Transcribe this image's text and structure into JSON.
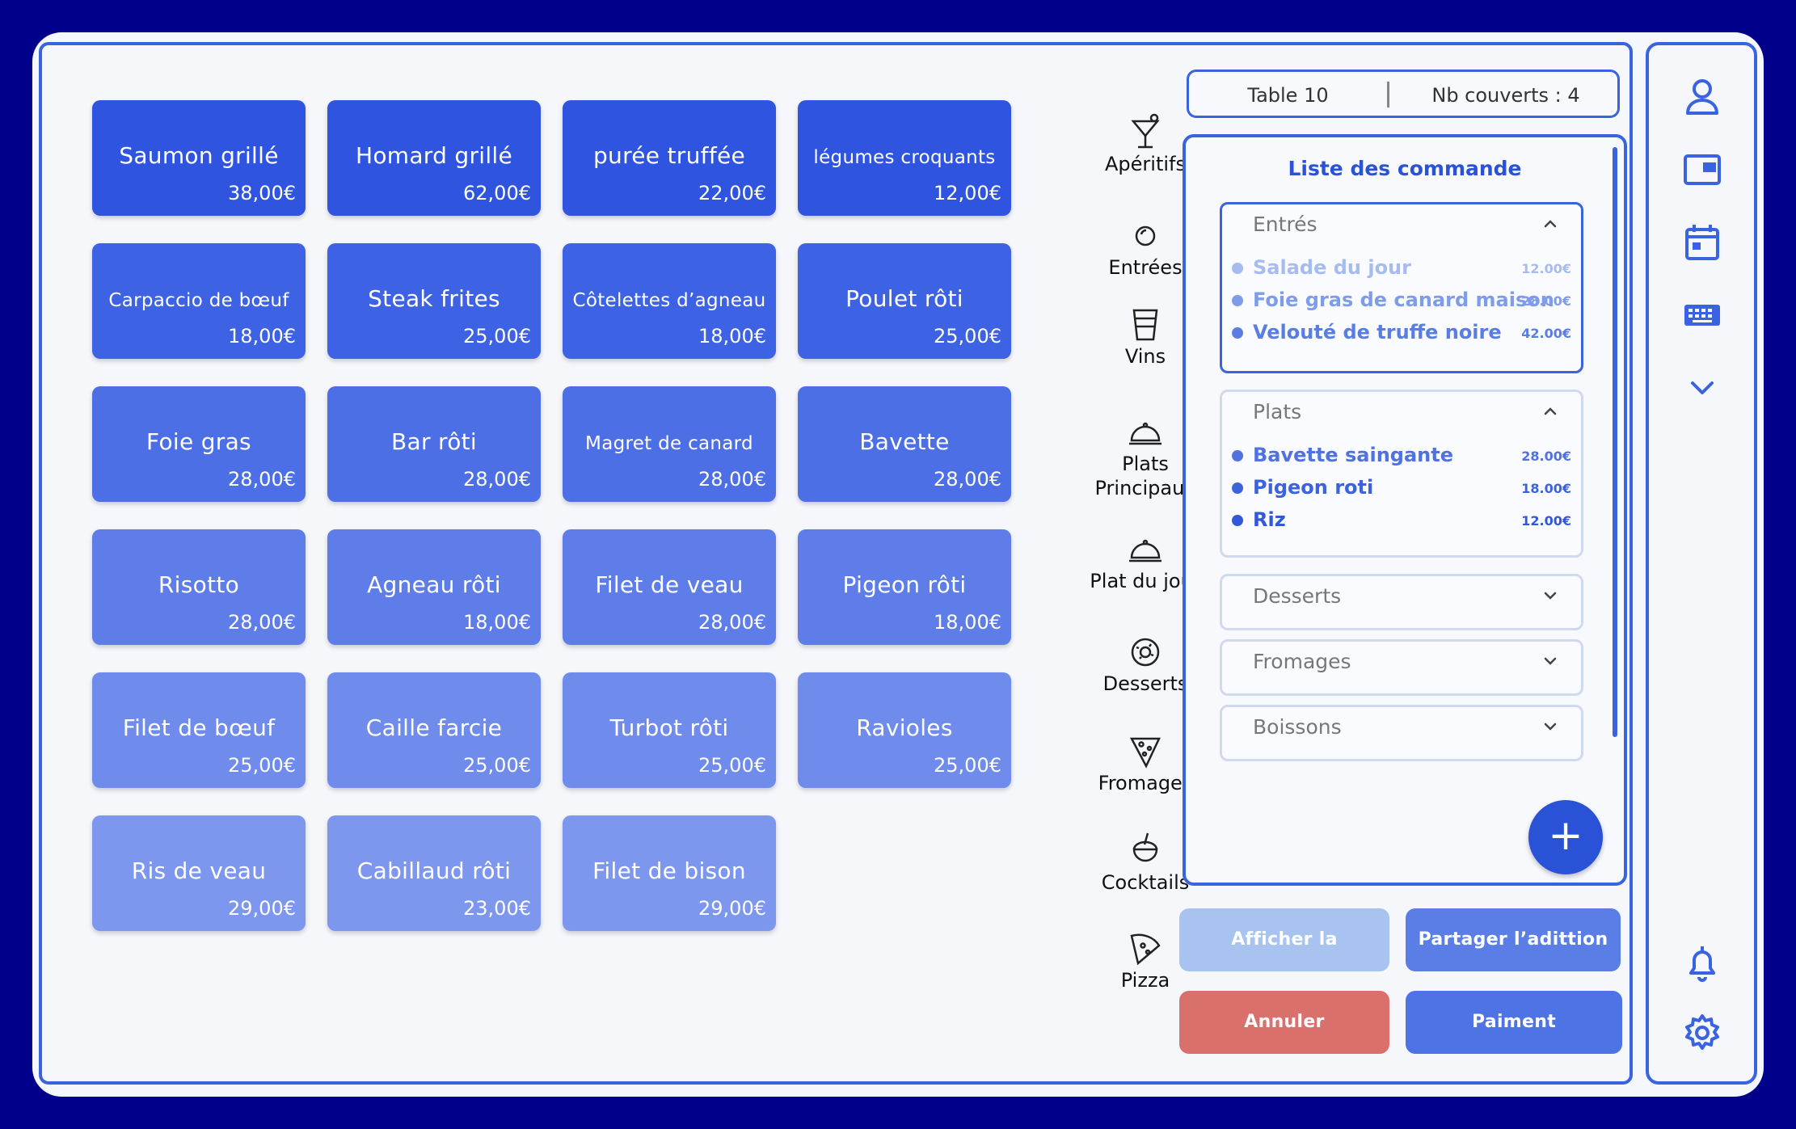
{
  "dishes": [
    {
      "name": "Saumon grillé",
      "price": "38,00€",
      "color": "#2f55e0",
      "small": false
    },
    {
      "name": "Homard grillé",
      "price": "62,00€",
      "color": "#2f55e0",
      "small": false
    },
    {
      "name": "purée truffée",
      "price": "22,00€",
      "color": "#2f55e0",
      "small": false
    },
    {
      "name": "légumes croquants",
      "price": "12,00€",
      "color": "#2f55e0",
      "small": true
    },
    {
      "name": "Carpaccio de bœuf",
      "price": "18,00€",
      "color": "#3d62e3",
      "small": true
    },
    {
      "name": "Steak frites",
      "price": "25,00€",
      "color": "#3d62e3",
      "small": false
    },
    {
      "name": "Côtelettes d’agneau",
      "price": "18,00€",
      "color": "#3d62e3",
      "small": true
    },
    {
      "name": "Poulet rôti",
      "price": "25,00€",
      "color": "#3d62e3",
      "small": false
    },
    {
      "name": "Foie gras",
      "price": "28,00€",
      "color": "#4d6fe6",
      "small": false
    },
    {
      "name": "Bar rôti",
      "price": "28,00€",
      "color": "#4d6fe6",
      "small": false
    },
    {
      "name": "Magret de canard",
      "price": "28,00€",
      "color": "#4d6fe6",
      "small": true
    },
    {
      "name": "Bavette",
      "price": "28,00€",
      "color": "#4d6fe6",
      "small": false
    },
    {
      "name": "Risotto",
      "price": "28,00€",
      "color": "#5e7de9",
      "small": false
    },
    {
      "name": "Agneau rôti",
      "price": "18,00€",
      "color": "#5e7de9",
      "small": false
    },
    {
      "name": "Filet de veau",
      "price": "28,00€",
      "color": "#5e7de9",
      "small": false
    },
    {
      "name": "Pigeon rôti",
      "price": "18,00€",
      "color": "#5e7de9",
      "small": false
    },
    {
      "name": "Filet de bœuf",
      "price": "25,00€",
      "color": "#6f8beb",
      "small": false
    },
    {
      "name": "Caille farcie",
      "price": "25,00€",
      "color": "#6f8beb",
      "small": false
    },
    {
      "name": "Turbot rôti",
      "price": "25,00€",
      "color": "#6f8beb",
      "small": false
    },
    {
      "name": "Ravioles",
      "price": "25,00€",
      "color": "#6f8beb",
      "small": false
    },
    {
      "name": "Ris de veau",
      "price": "29,00€",
      "color": "#7e97ee",
      "small": false
    },
    {
      "name": "Cabillaud rôti",
      "price": "23,00€",
      "color": "#7e97ee",
      "small": false
    },
    {
      "name": "Filet de bison",
      "price": "29,00€",
      "color": "#7e97ee",
      "small": false
    }
  ],
  "categories": [
    {
      "label": "Apéritifs",
      "icon": "cocktail-glass-icon"
    },
    {
      "label": "Entrées",
      "icon": "plate-icon"
    },
    {
      "label": "Vins",
      "icon": "wine-cup-icon"
    },
    {
      "label": "Plats Principaux",
      "icon": "cloche-icon"
    },
    {
      "label": "Plat du jour",
      "icon": "cloche-icon"
    },
    {
      "label": "Desserts",
      "icon": "donut-icon"
    },
    {
      "label": "Fromages",
      "icon": "cheese-icon"
    },
    {
      "label": "Cocktails",
      "icon": "coconut-drink-icon"
    },
    {
      "label": "Pizza",
      "icon": "pizza-slice-icon"
    }
  ],
  "table_header": {
    "table": "Table 10",
    "covers": "Nb couverts : 4"
  },
  "order": {
    "title": "Liste des commande",
    "sections": [
      {
        "title": "Entrés",
        "expanded": true,
        "items": [
          {
            "name": "Salade du jour",
            "price": "12.00€",
            "color": "#a6bcef"
          },
          {
            "name": "Foie gras de canard maison",
            "price": "28.00€",
            "color": "#7f9ce8"
          },
          {
            "name": "Velouté de truffe noire",
            "price": "42.00€",
            "color": "#5a7de2"
          }
        ]
      },
      {
        "title": "Plats",
        "expanded": true,
        "items": [
          {
            "name": "Bavette saingante",
            "price": "28.00€",
            "color": "#4f72e0"
          },
          {
            "name": "Pigeon roti",
            "price": "18.00€",
            "color": "#3d63dc"
          },
          {
            "name": "Riz",
            "price": "12.00€",
            "color": "#3158d8"
          }
        ]
      },
      {
        "title": "Desserts",
        "expanded": false,
        "items": []
      },
      {
        "title": "Fromages",
        "expanded": false,
        "items": []
      },
      {
        "title": "Boissons",
        "expanded": false,
        "items": []
      }
    ],
    "add_label": "+"
  },
  "buttons": {
    "show_order": "Afficher la commande",
    "split_bill": "Partager l’adittion",
    "cancel": "Annuler",
    "pay": "Paiment"
  },
  "sidebar_icons": [
    "user-icon",
    "window-icon",
    "calendar-icon",
    "keyboard-icon",
    "chevron-down-icon",
    "bell-icon",
    "gear-icon"
  ],
  "colors": {
    "frame": "#00008b",
    "accent": "#3a63e0",
    "cancel": "#d9706b",
    "show_order": "#a8c3ef",
    "split": "#5b7ee6",
    "pay": "#4d73e4"
  }
}
